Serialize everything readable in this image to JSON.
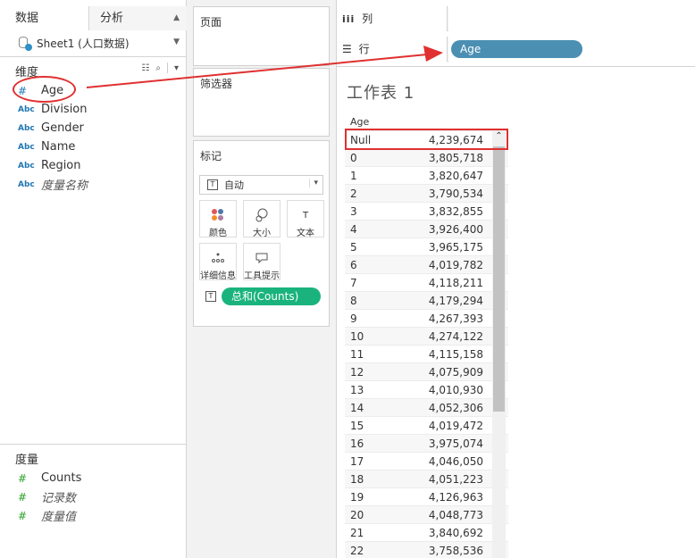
{
  "left_pane": {
    "tab_data": "数据",
    "tab_analysis": "分析",
    "datasource": "Sheet1 (人口数据)",
    "dimensions_label": "维度",
    "dimensions": [
      {
        "type": "number",
        "name": "Age"
      },
      {
        "type": "abc",
        "name": "Division"
      },
      {
        "type": "abc",
        "name": "Gender"
      },
      {
        "type": "abc",
        "name": "Name"
      },
      {
        "type": "abc",
        "name": "Region"
      },
      {
        "type": "abc",
        "name": "度量名称"
      }
    ],
    "abc_badge": "Abc",
    "measures_label": "度量",
    "measures": [
      {
        "type": "number",
        "name": "Counts"
      },
      {
        "type": "number",
        "name": "记录数"
      },
      {
        "type": "number",
        "name": "度量值"
      }
    ]
  },
  "shelves": {
    "pages_label": "页面",
    "filters_label": "筛选器",
    "marks_label": "标记",
    "marks_type": "自动",
    "mark_buttons": [
      "颜色",
      "大小",
      "文本",
      "详细信息",
      "工具提示"
    ],
    "text_pill": "总和(Counts)",
    "columns_label": "列",
    "rows_label": "行",
    "rows_pill": "Age"
  },
  "view": {
    "sheet_title": "工作表 1",
    "column_header": "Age",
    "rows": [
      {
        "k": "Null",
        "v": "4,239,674"
      },
      {
        "k": "0",
        "v": "3,805,718"
      },
      {
        "k": "1",
        "v": "3,820,647"
      },
      {
        "k": "2",
        "v": "3,790,534"
      },
      {
        "k": "3",
        "v": "3,832,855"
      },
      {
        "k": "4",
        "v": "3,926,400"
      },
      {
        "k": "5",
        "v": "3,965,175"
      },
      {
        "k": "6",
        "v": "4,019,782"
      },
      {
        "k": "7",
        "v": "4,118,211"
      },
      {
        "k": "8",
        "v": "4,179,294"
      },
      {
        "k": "9",
        "v": "4,267,393"
      },
      {
        "k": "10",
        "v": "4,274,122"
      },
      {
        "k": "11",
        "v": "4,115,158"
      },
      {
        "k": "12",
        "v": "4,075,909"
      },
      {
        "k": "13",
        "v": "4,010,930"
      },
      {
        "k": "14",
        "v": "4,052,306"
      },
      {
        "k": "15",
        "v": "4,019,472"
      },
      {
        "k": "16",
        "v": "3,975,074"
      },
      {
        "k": "17",
        "v": "4,046,050"
      },
      {
        "k": "18",
        "v": "4,051,223"
      },
      {
        "k": "19",
        "v": "4,126,963"
      },
      {
        "k": "20",
        "v": "4,048,773"
      },
      {
        "k": "21",
        "v": "3,840,692"
      },
      {
        "k": "22",
        "v": "3,758,536"
      }
    ]
  },
  "colors": {
    "rows_pill": "#4b8fb3",
    "measure_pill": "#1ab37e",
    "annotation": "#e03030"
  }
}
